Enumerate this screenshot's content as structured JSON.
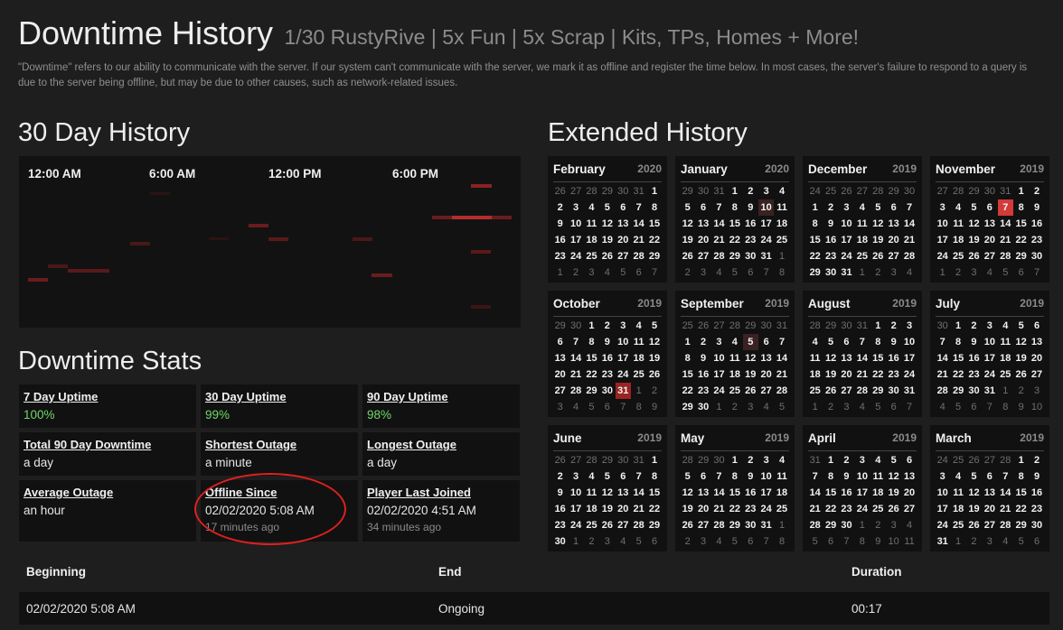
{
  "header": {
    "title": "Downtime History",
    "server_name": "1/30 RustyRive | 5x Fun | 5x Scrap | Kits, TPs, Homes + More!",
    "description": "\"Downtime\" refers to our ability to communicate with the server. If our system can't communicate with the server, we mark it as offline and register the time below. In most cases, the server's failure to respond to a query is due to the server being offline, but may be due to other causes, such as network-related issues."
  },
  "day_history": {
    "title": "30 Day History",
    "time_labels": [
      "12:00 AM",
      "6:00 AM",
      "12:00 PM",
      "6:00 PM"
    ],
    "accent_color": "#b32d2d"
  },
  "stats": {
    "title": "Downtime Stats",
    "items": [
      {
        "label": "7 Day Uptime",
        "value": "100%"
      },
      {
        "label": "30 Day Uptime",
        "value": "99%"
      },
      {
        "label": "90 Day Uptime",
        "value": "98%"
      },
      {
        "label": "Total 90 Day Downtime",
        "value": "a day"
      },
      {
        "label": "Shortest Outage",
        "value": "a minute"
      },
      {
        "label": "Longest Outage",
        "value": "a day"
      },
      {
        "label": "Average Outage",
        "value": "an hour"
      },
      {
        "label": "Offline Since",
        "value": "02/02/2020 5:08 AM",
        "sub": "17 minutes ago"
      },
      {
        "label": "Player Last Joined",
        "value": "02/02/2020 4:51 AM",
        "sub": "34 minutes ago"
      }
    ],
    "uptime_color": "#6ed86e"
  },
  "extended_history": {
    "title": "Extended History",
    "months": [
      {
        "name": "February",
        "year": "2020",
        "start": 26,
        "prev_days": 31,
        "days": 29,
        "rows": 6,
        "mark": {}
      },
      {
        "name": "January",
        "year": "2020",
        "start": 29,
        "prev_days": 31,
        "days": 31,
        "rows": 6,
        "mark": {
          "10": "r1"
        }
      },
      {
        "name": "December",
        "year": "2019",
        "start": 24,
        "prev_days": 30,
        "days": 31,
        "rows": 6,
        "mark": {}
      },
      {
        "name": "November",
        "year": "2019",
        "start": 27,
        "prev_days": 31,
        "days": 30,
        "rows": 6,
        "mark": {
          "7": "r3"
        }
      },
      {
        "name": "October",
        "year": "2019",
        "start": 29,
        "prev_days": 30,
        "days": 31,
        "rows": 6,
        "mark": {
          "31": "r2"
        }
      },
      {
        "name": "September",
        "year": "2019",
        "start": 25,
        "prev_days": 31,
        "days": 30,
        "rows": 6,
        "mark": {
          "5": "r1"
        }
      },
      {
        "name": "August",
        "year": "2019",
        "start": 28,
        "prev_days": 31,
        "days": 31,
        "rows": 6,
        "mark": {}
      },
      {
        "name": "July",
        "year": "2019",
        "start": 30,
        "prev_days": 30,
        "days": 31,
        "rows": 6,
        "mark": {}
      },
      {
        "name": "June",
        "year": "2019",
        "start": 26,
        "prev_days": 31,
        "days": 30,
        "rows": 6,
        "mark": {}
      },
      {
        "name": "May",
        "year": "2019",
        "start": 28,
        "prev_days": 30,
        "days": 31,
        "rows": 6,
        "mark": {}
      },
      {
        "name": "April",
        "year": "2019",
        "start": 31,
        "prev_days": 31,
        "days": 30,
        "rows": 6,
        "mark": {}
      },
      {
        "name": "March",
        "year": "2019",
        "start": 24,
        "prev_days": 28,
        "days": 31,
        "rows": 6,
        "mark": {}
      }
    ]
  },
  "outage_table": {
    "headers": [
      "Beginning",
      "End",
      "Duration"
    ],
    "rows": [
      {
        "beginning": "02/02/2020 5:08 AM",
        "end": "Ongoing",
        "duration": "00:17"
      }
    ]
  }
}
